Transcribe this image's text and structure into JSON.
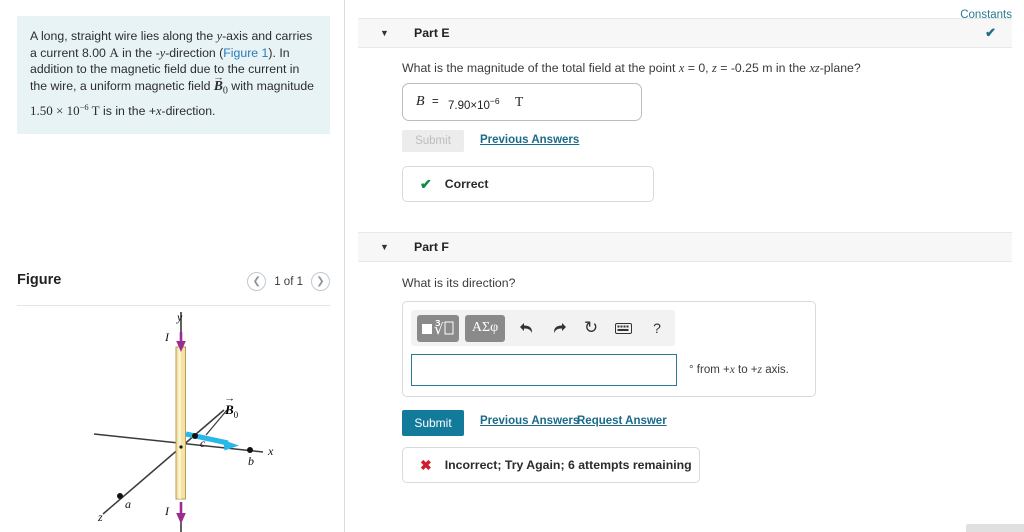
{
  "problem": {
    "line1": "A long, straight wire lies along the ",
    "y_axis": "y",
    "line1b": "-axis and carries a",
    "line2a": "current 8.00 ",
    "current_unit": "A",
    "line2b": " in the -",
    "line2c": "-direction (",
    "figure_link": "Figure 1",
    "line2d": "). In addition to",
    "line3": "the magnetic field due to the current in the wire, a",
    "line4a": "uniform magnetic field ",
    "field_symbol": "B",
    "field_sub": "0",
    "line4b": " with magnitude",
    "line5a": "1.50 ",
    "times": "×",
    "line5b": " 10",
    "exponent": "−6",
    "line5c": " T",
    "line5d": " is in the +",
    "x_axis": "x",
    "line5e": "-direction."
  },
  "figure": {
    "title": "Figure",
    "prev_icon": "chevron-left-icon",
    "next_icon": "chevron-right-icon",
    "counter": "1 of 1",
    "labels": {
      "y_axis": "y",
      "x_axis": "x",
      "z_axis": "z",
      "current_top": "I",
      "current_bottom": "I",
      "point_a": "a",
      "point_b": "b",
      "point_c": "c",
      "field_vector": "B",
      "field_vector_sub": "0"
    },
    "colors": {
      "wire": "#f2dd9e",
      "current_arrow": "#9b2d8f",
      "field_arrow": "#29b6e8",
      "axis": "#3a3a3a"
    }
  },
  "header": {
    "constants_label": "Constants"
  },
  "part_e": {
    "caret": "▼",
    "label": "Part E",
    "check_icon": "✔",
    "question": "What is the magnitude of the total field at the point x = 0, z = -0.25 m in the xz-plane?",
    "question_parts": {
      "a": "What is the magnitude of the total field at the point ",
      "x": "x",
      "b": " = 0, ",
      "z": "z",
      "c": " = -0.25 m in the ",
      "xz": "xz",
      "d": "-plane?"
    },
    "answer": {
      "symbol": "B",
      "equals": "=",
      "mantissa": "7.90×10",
      "exponent": "−6",
      "unit": "T"
    },
    "submit_label": "Submit",
    "submit_enabled": false,
    "previous_answers_label": "Previous Answers",
    "feedback": {
      "icon": "check-icon",
      "text": "Correct",
      "color": "#0f8a42"
    }
  },
  "part_f": {
    "caret": "▼",
    "label": "Part F",
    "question": "What is its direction?",
    "toolbar": {
      "template_icon": "math-template-icon",
      "greek_icon": "ΑΣφ",
      "undo_icon": "⬅",
      "redo_icon": "➡",
      "reset_icon": "↺",
      "keyboard_icon": "keyboard-icon",
      "help_icon": "?"
    },
    "input_value": "",
    "units_label": "° from +x to +z axis.",
    "units_parts": {
      "deg": "° from +",
      "x": "x",
      "mid": " to +",
      "z": "z",
      "end": " axis."
    },
    "submit_label": "Submit",
    "submit_enabled": true,
    "previous_answers_label": "Previous Answers",
    "request_answer_label": "Request Answer",
    "feedback": {
      "icon": "x-icon",
      "text": "Incorrect; Try Again; 6 attempts remaining",
      "color": "#cf1d30"
    }
  }
}
